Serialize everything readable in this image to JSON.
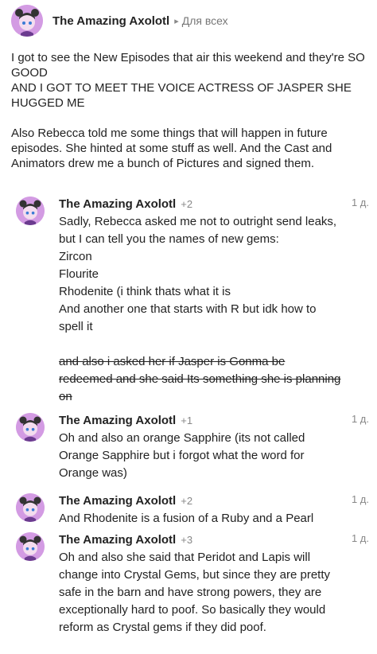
{
  "post": {
    "author": "The Amazing Axolotl",
    "audience": "Для всех",
    "paragraph1": "I got to see the New Episodes that air this weekend and they're SO GOOD\nAND I GOT TO MEET THE VOICE ACTRESS OF JASPER SHE HUGGED ME",
    "paragraph2": "Also Rebecca told me some things that will happen in future episodes. She hinted at some stuff as well. And the Cast and Animators drew me a bunch of Pictures and signed them."
  },
  "replies": [
    {
      "author": "The Amazing Axolotl",
      "plus": "+2",
      "time": "1 д.",
      "text": "Sadly, Rebecca asked me not to outright send leaks, but I can tell you the names of new gems:\nZircon\nFlourite\nRhodenite (i think thats what it is\nAnd another one that starts with R but idk how to spell it",
      "strike": "and also i asked her if Jasper is Gonma be redeemed and she said Its something she is planning on"
    },
    {
      "author": "The Amazing Axolotl",
      "plus": "+1",
      "time": "1 д.",
      "text": "Oh and also an orange Sapphire (its not called Orange Sapphire but i forgot what the word for Orange was)"
    },
    {
      "author": "The Amazing Axolotl",
      "plus": "+2",
      "time": "1 д.",
      "text": "And Rhodenite is a fusion of a Ruby and a Pearl"
    },
    {
      "author": "The Amazing Axolotl",
      "plus": "+3",
      "time": "1 д.",
      "text": "Oh and also she said that Peridot and Lapis will change into Crystal Gems, but since they are pretty safe in the barn and have strong powers, they are exceptionally hard to poof. So basically they would reform as Crystal gems if they did poof."
    }
  ],
  "icons": {
    "avatar": "axolotl-girl-avatar-icon",
    "arrow": "triangle-right-icon"
  },
  "colors": {
    "avatar_bg": "#d39be3",
    "muted_text": "#888888"
  }
}
